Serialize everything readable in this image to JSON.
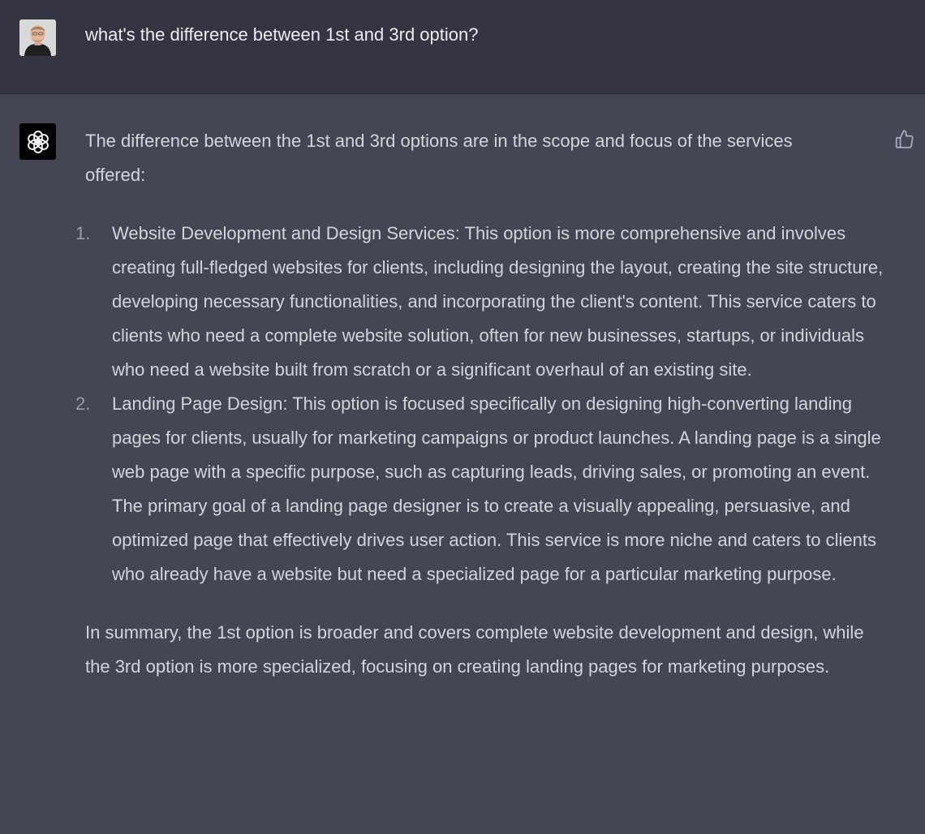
{
  "user_message": {
    "text": "what's the difference between 1st and 3rd option?"
  },
  "assistant_message": {
    "intro": "The difference between the 1st and 3rd options are in the scope and focus of the services offered:",
    "items": [
      {
        "number": "1.",
        "text": "Website Development and Design Services: This option is more comprehensive and involves creating full-fledged websites for clients, including designing the layout, creating the site structure, developing necessary functionalities, and incorporating the client's content. This service caters to clients who need a complete website solution, often for new businesses, startups, or individuals who need a website built from scratch or a significant overhaul of an existing site."
      },
      {
        "number": "2.",
        "text": "Landing Page Design: This option is focused specifically on designing high-converting landing pages for clients, usually for marketing campaigns or product launches. A landing page is a single web page with a specific purpose, such as capturing leads, driving sales, or promoting an event. The primary goal of a landing page designer is to create a visually appealing, persuasive, and optimized page that effectively drives user action. This service is more niche and caters to clients who already have a website but need a specialized page for a particular marketing purpose."
      }
    ],
    "summary": "In summary, the 1st option is broader and covers complete website development and design, while the 3rd option is more specialized, focusing on creating landing pages for marketing purposes."
  },
  "icons": {
    "user_avatar": "user-avatar-photo",
    "assistant_avatar": "openai-logo-icon",
    "feedback": "thumbs-up-icon"
  },
  "colors": {
    "user_row_bg": "#343541",
    "assistant_row_bg": "#444654",
    "text": "#d1d5db",
    "assistant_avatar_bg": "#000000"
  }
}
